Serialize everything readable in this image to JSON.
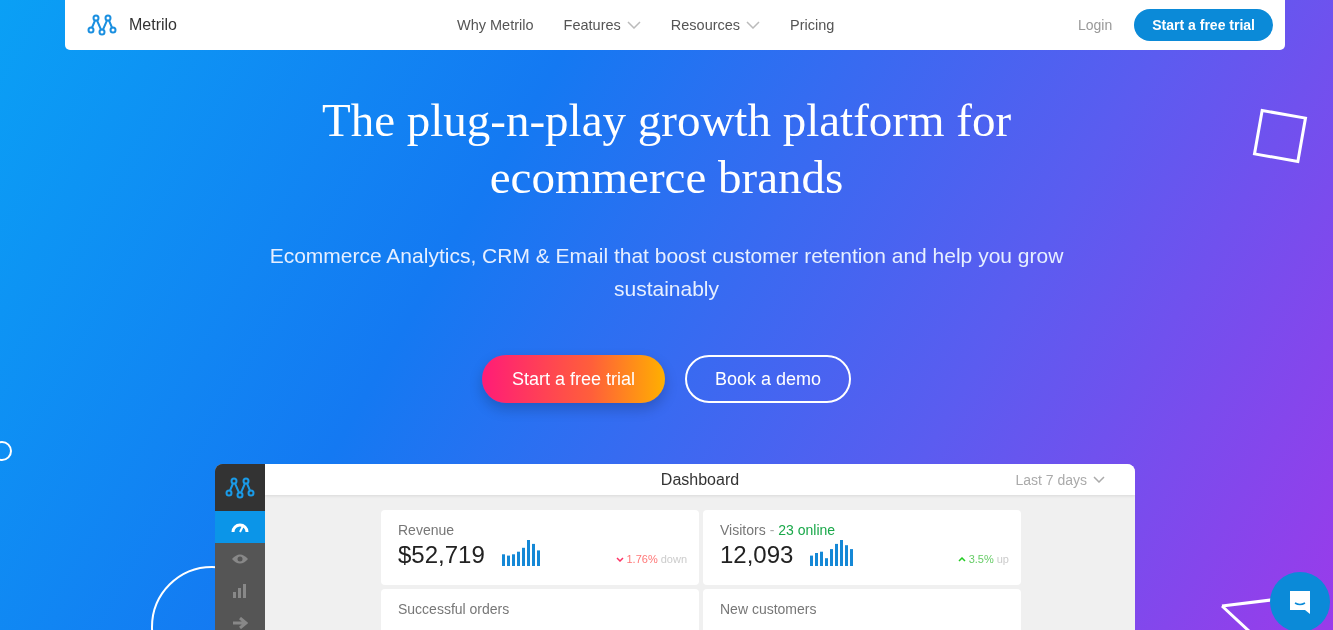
{
  "nav": {
    "brand": "Metrilo",
    "links": [
      {
        "label": "Why Metrilo",
        "dropdown": false
      },
      {
        "label": "Features",
        "dropdown": true
      },
      {
        "label": "Resources",
        "dropdown": true
      },
      {
        "label": "Pricing",
        "dropdown": false
      }
    ],
    "login": "Login",
    "cta": "Start a free trial"
  },
  "hero": {
    "title": "The plug-n-play growth platform for ecommerce brands",
    "subtitle": "Ecommerce Analytics, CRM & Email that boost customer retention and help you grow sustainably",
    "primary_button": "Start a free trial",
    "secondary_button": "Book a demo"
  },
  "dashboard": {
    "title": "Dashboard",
    "range": "Last 7 days",
    "sidebar": [
      {
        "kind": "gauge",
        "selected": true
      },
      {
        "kind": "eye",
        "selected": false
      },
      {
        "kind": "bars",
        "selected": false
      },
      {
        "kind": "arrow",
        "selected": false
      }
    ],
    "cards": [
      {
        "label": "Revenue",
        "value": "$52,719",
        "kind": "down",
        "change": "1.76%",
        "trend": "down"
      },
      {
        "label": "Visitors",
        "separator": "-",
        "online": "23 online",
        "value": "12,093",
        "kind": "up",
        "change": "3.5%",
        "trend": "up"
      },
      {
        "label": "Successful orders"
      },
      {
        "label": "New customers"
      }
    ]
  }
}
